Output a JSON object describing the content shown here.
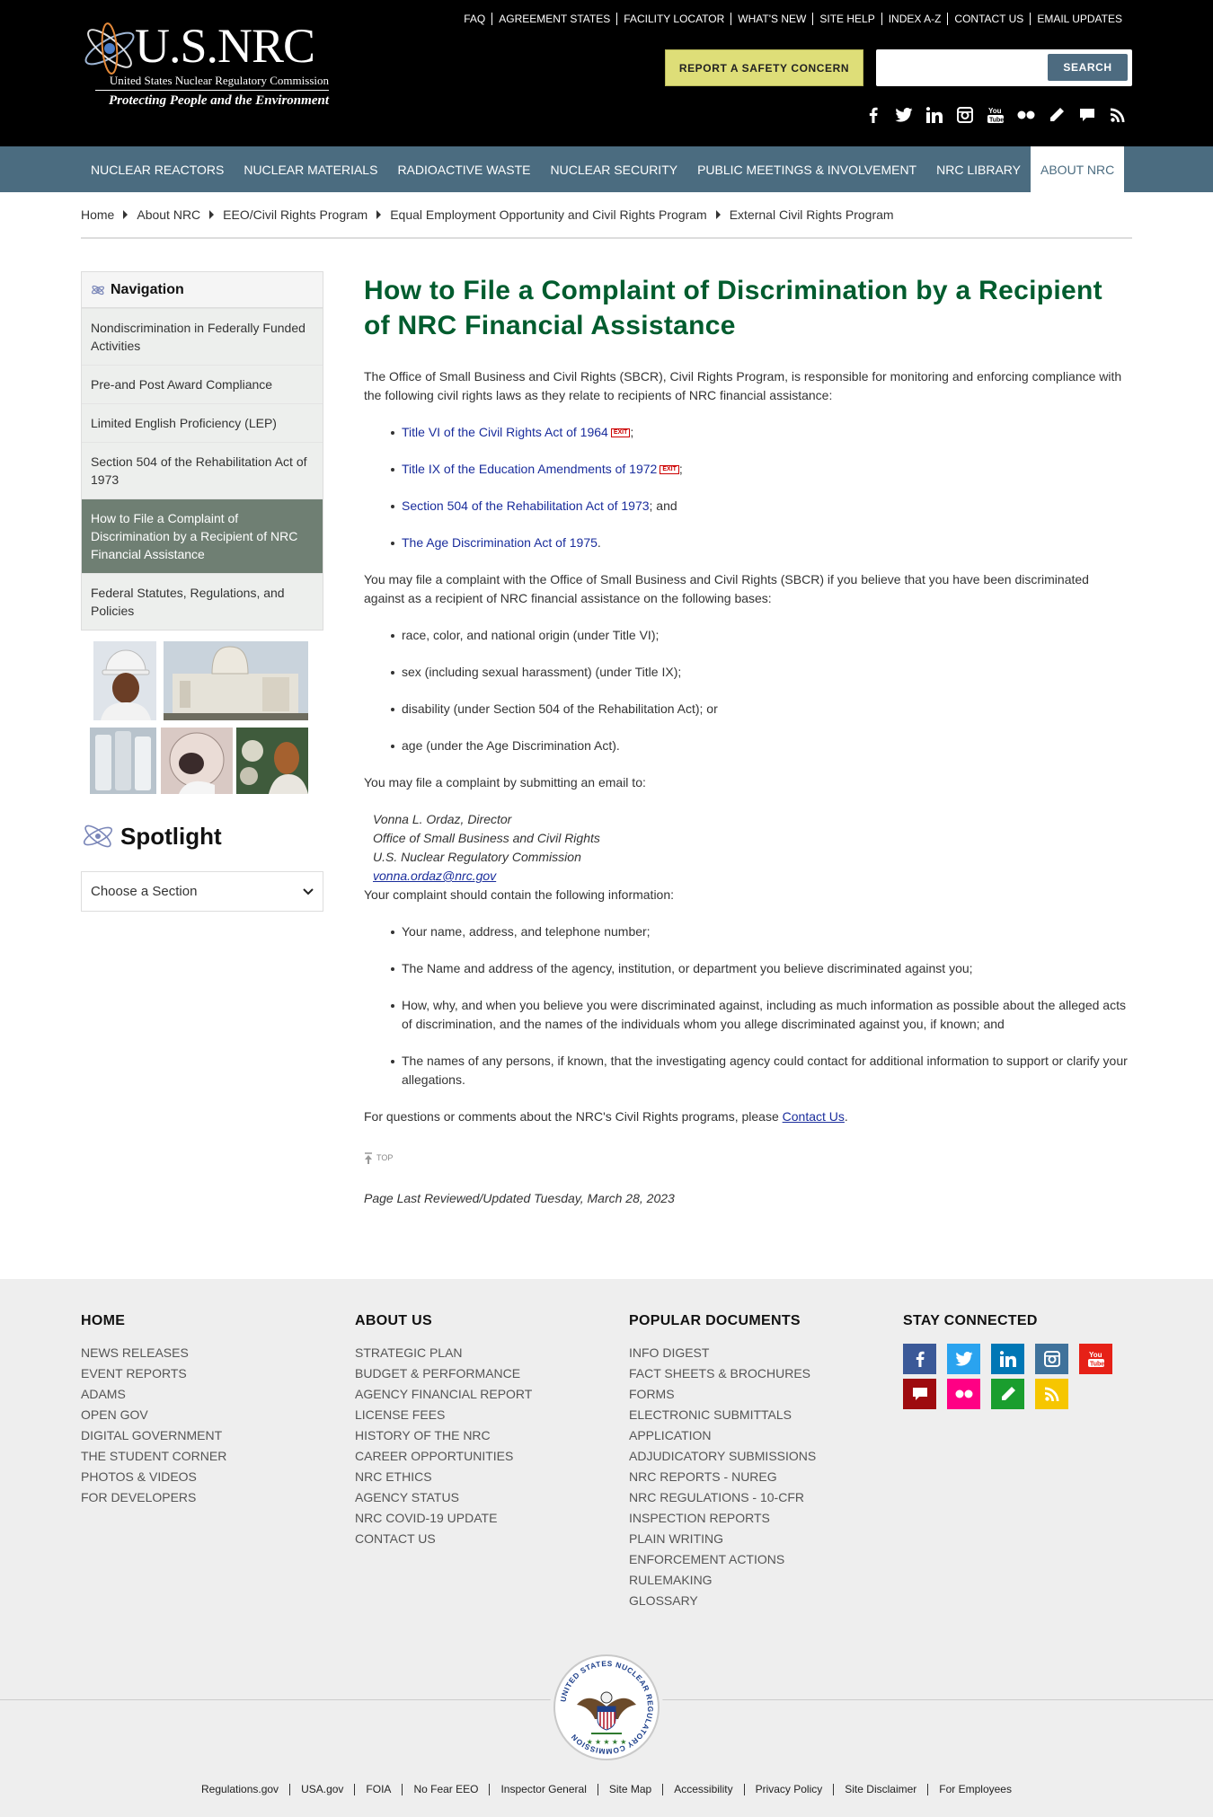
{
  "header": {
    "logo_title": "U.S.NRC",
    "logo_subtitle": "United States Nuclear Regulatory Commission",
    "logo_tagline": "Protecting People and the Environment",
    "utility_links": [
      "FAQ",
      "AGREEMENT STATES",
      "FACILITY LOCATOR",
      "WHAT'S NEW",
      "SITE HELP",
      "INDEX A-Z",
      "CONTACT US",
      "EMAIL UPDATES"
    ],
    "safety_button": "REPORT A SAFETY CONCERN",
    "search_value": "",
    "search_button": "SEARCH",
    "social_icons": [
      "facebook-icon",
      "twitter-icon",
      "linkedin-icon",
      "instagram-icon",
      "youtube-icon",
      "flickr-icon",
      "blog-pencil-icon",
      "comment-icon",
      "rss-icon"
    ]
  },
  "nav": {
    "items": [
      "NUCLEAR REACTORS",
      "NUCLEAR MATERIALS",
      "RADIOACTIVE WASTE",
      "NUCLEAR SECURITY",
      "PUBLIC MEETINGS & INVOLVEMENT",
      "NRC LIBRARY",
      "ABOUT NRC"
    ],
    "active": "ABOUT NRC"
  },
  "breadcrumb": [
    "Home",
    "About NRC",
    "EEO/Civil Rights Program",
    "Equal Employment Opportunity and Civil Rights Program",
    "External Civil Rights Program"
  ],
  "sidebar": {
    "heading": "Navigation",
    "items": [
      "Nondiscrimination in Federally Funded Activities",
      "Pre-and Post Award Compliance",
      "Limited English Proficiency (LEP)",
      "Section 504 of the Rehabilitation Act of 1973",
      "How to File a Complaint of Discrimination by a Recipient of NRC Financial Assistance",
      "Federal Statutes, Regulations, and Policies"
    ],
    "active_index": 4,
    "spotlight_heading": "Spotlight",
    "section_select": "Choose a Section"
  },
  "main": {
    "title": "How to File a Complaint of Discrimination by a Recipient of NRC Financial Assistance",
    "intro": "The Office of Small Business and Civil Rights (SBCR), Civil Rights Program, is responsible for monitoring and enforcing compliance with the following civil rights laws as they relate to recipients of NRC financial assistance:",
    "laws": [
      {
        "text": "Title VI of the Civil Rights Act of 1964",
        "exit": true,
        "suffix": ";"
      },
      {
        "text": "Title IX of the Education Amendments of 1972",
        "exit": true,
        "suffix": ";"
      },
      {
        "text": "Section 504 of the Rehabilitation Act of 1973",
        "exit": false,
        "suffix": "; and"
      },
      {
        "text": "The Age Discrimination Act of 1975",
        "exit": false,
        "suffix": "."
      }
    ],
    "exit_badge": "EXIT",
    "bases_intro": "You may file a complaint with the Office of Small Business and Civil Rights (SBCR) if you believe that you have been discriminated against as a recipient of NRC financial assistance on the following bases:",
    "bases": [
      "race, color, and national origin (under Title VI);",
      "sex (including sexual harassment) (under Title IX);",
      "disability (under Section 504 of the Rehabilitation Act); or",
      "age (under the Age Discrimination Act)."
    ],
    "email_intro": "You may file a complaint by submitting an email to:",
    "address": {
      "name": "Vonna L. Ordaz, Director",
      "office": "Office of Small Business and Civil Rights",
      "agency": "U.S. Nuclear Regulatory Commission",
      "email": "vonna.ordaz@nrc.gov"
    },
    "info_intro": "Your complaint should contain the following information:",
    "info_items": [
      "Your name, address, and telephone number;",
      "The Name and address of the agency, institution, or department you believe discriminated against you;",
      "How, why, and when you believe you were discriminated against, including as much information as possible about the alleged acts of discrimination, and the names of the individuals whom you allege discriminated against you, if known; and",
      "The names of any persons, if known, that the investigating agency could contact for additional information to support or clarify your allegations."
    ],
    "questions_prefix": "For questions or comments about the NRC's Civil Rights programs, please ",
    "questions_link": "Contact Us",
    "questions_suffix": ".",
    "top_label": "TOP",
    "reviewed": "Page Last Reviewed/Updated Tuesday, March 28, 2023"
  },
  "footer": {
    "home": {
      "heading": "HOME",
      "links": [
        "NEWS RELEASES",
        "EVENT REPORTS",
        "ADAMS",
        "OPEN GOV",
        "DIGITAL GOVERNMENT",
        "THE STUDENT CORNER",
        "PHOTOS & VIDEOS",
        "FOR DEVELOPERS"
      ]
    },
    "about": {
      "heading": "ABOUT US",
      "links": [
        "STRATEGIC PLAN",
        "BUDGET & PERFORMANCE",
        "AGENCY FINANCIAL REPORT",
        "LICENSE FEES",
        "HISTORY OF THE NRC",
        "CAREER OPPORTUNITIES",
        "NRC ETHICS",
        "AGENCY STATUS",
        "NRC COVID-19 UPDATE",
        "CONTACT US"
      ]
    },
    "popular": {
      "heading": "POPULAR DOCUMENTS",
      "links": [
        "INFO DIGEST",
        "FACT SHEETS & BROCHURES",
        "FORMS",
        "ELECTRONIC SUBMITTALS",
        "APPLICATION",
        "ADJUDICATORY SUBMISSIONS",
        "NRC REPORTS - NUREG",
        "NRC REGULATIONS - 10-CFR",
        "INSPECTION REPORTS",
        "PLAIN WRITING",
        "ENFORCEMENT ACTIONS",
        "RULEMAKING",
        "GLOSSARY"
      ]
    },
    "connected": {
      "heading": "STAY CONNECTED",
      "icons": [
        {
          "name": "facebook-icon",
          "color": "#3b5998"
        },
        {
          "name": "twitter-icon",
          "color": "#2aa3ef"
        },
        {
          "name": "linkedin-icon",
          "color": "#0077b5"
        },
        {
          "name": "instagram-icon",
          "color": "#3f729b"
        },
        {
          "name": "youtube-icon",
          "color": "#e62117"
        },
        {
          "name": "comment-icon",
          "color": "#9e0b0f"
        },
        {
          "name": "flickr-icon",
          "color": "#ff0084"
        },
        {
          "name": "blog-pencil-icon",
          "color": "#1a9e2e"
        },
        {
          "name": "rss-icon",
          "color": "#f6c600"
        }
      ]
    },
    "seal_text": "UNITED STATES NUCLEAR REGULATORY COMMISSION",
    "bottom_links": [
      "Regulations.gov",
      "USA.gov",
      "FOIA",
      "No Fear EEO",
      "Inspector General",
      "Site Map",
      "Accessibility",
      "Privacy Policy",
      "Site Disclaimer",
      "For Employees"
    ]
  },
  "colors": {
    "header_bg": "#000000",
    "nav_bg": "#4b6c80",
    "title_green": "#005c2e",
    "link_blue": "#1a2d9c",
    "safety_yellow": "#dede78",
    "sidebar_active": "#6f7f73",
    "footer_bg": "#eeeeee"
  }
}
